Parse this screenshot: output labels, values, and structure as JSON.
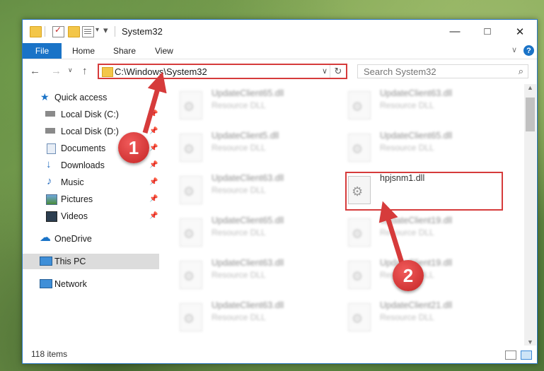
{
  "window": {
    "title": "System32"
  },
  "ribbon": {
    "tabs": [
      "File",
      "Home",
      "Share",
      "View"
    ],
    "help": "?"
  },
  "address": {
    "path": "C:\\Windows\\System32"
  },
  "search": {
    "placeholder": "Search System32"
  },
  "nav": {
    "items": [
      {
        "label": "Quick access",
        "icon": "star-icon",
        "pinned": false
      },
      {
        "label": "Local Disk (C:)",
        "icon": "drive-icon",
        "pinned": true
      },
      {
        "label": "Local Disk (D:)",
        "icon": "drive-icon",
        "pinned": true
      },
      {
        "label": "Documents",
        "icon": "document-icon",
        "pinned": true
      },
      {
        "label": "Downloads",
        "icon": "download-icon",
        "pinned": true
      },
      {
        "label": "Music",
        "icon": "music-icon",
        "pinned": true
      },
      {
        "label": "Pictures",
        "icon": "picture-icon",
        "pinned": true
      },
      {
        "label": "Videos",
        "icon": "video-icon",
        "pinned": true
      },
      {
        "label": "OneDrive",
        "icon": "cloud-icon",
        "pinned": false
      },
      {
        "label": "This PC",
        "icon": "computer-icon",
        "pinned": false,
        "selected": true
      },
      {
        "label": "Network",
        "icon": "network-icon",
        "pinned": false
      }
    ]
  },
  "files": [
    {
      "name": "UpdateClient65.dll",
      "type": "Resource DLL",
      "blurred": true
    },
    {
      "name": "UpdateClient63.dll",
      "type": "Resource DLL",
      "blurred": true
    },
    {
      "name": "UpdateClient5.dll",
      "type": "Resource DLL",
      "blurred": true
    },
    {
      "name": "UpdateClient65.dll",
      "type": "Resource DLL",
      "blurred": true
    },
    {
      "name": "UpdateClient63.dll",
      "type": "Resource DLL",
      "blurred": true
    },
    {
      "name": "hpjsnm1.dll",
      "type": "",
      "blurred": false
    },
    {
      "name": "UpdateClient65.dll",
      "type": "Resource DLL",
      "blurred": true
    },
    {
      "name": "UpdateClient19.dll",
      "type": "Resource DLL",
      "blurred": true
    },
    {
      "name": "UpdateClient63.dll",
      "type": "Resource DLL",
      "blurred": true
    },
    {
      "name": "UpdateClient19.dll",
      "type": "Resource DLL",
      "blurred": true
    },
    {
      "name": "UpdateClient63.dll",
      "type": "Resource DLL",
      "blurred": true
    },
    {
      "name": "UpdateClient21.dll",
      "type": "Resource DLL",
      "blurred": true
    }
  ],
  "status": {
    "item_count": "118 items"
  },
  "annotations": {
    "step1": "1",
    "step2": "2",
    "color": "#d63b3b"
  }
}
